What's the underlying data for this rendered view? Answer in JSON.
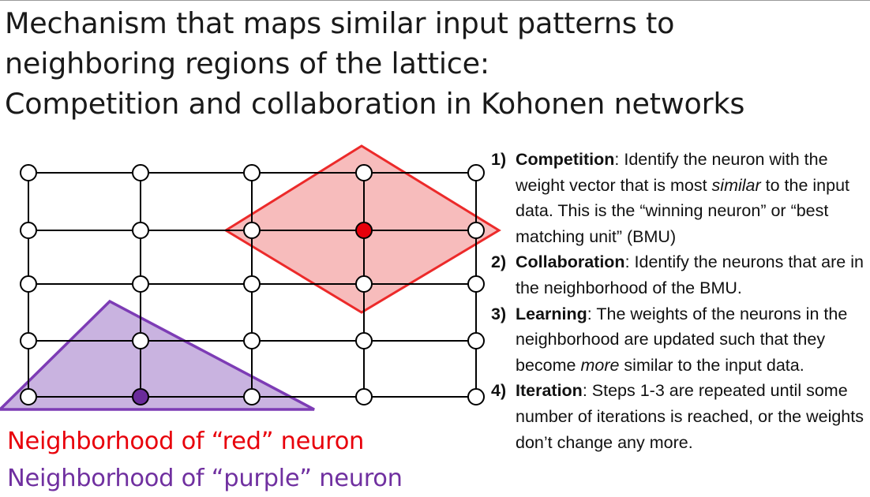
{
  "title": {
    "lines": [
      "Mechanism that maps similar input patterns to",
      "neighboring regions of the lattice:",
      "Competition and collaboration in Kohonen networks"
    ]
  },
  "diagram": {
    "grid": {
      "columns": 5,
      "rows": 5,
      "node_fill": "#ffffff",
      "line_color": "#000000"
    },
    "red_neuron": {
      "column": 4,
      "row": 2,
      "color": "#e8000b"
    },
    "purple_neuron": {
      "column": 2,
      "row": 5,
      "color": "#6a2b9b"
    },
    "red_region": {
      "fill": "#f4a6a6",
      "stroke": "#ec2a2a"
    },
    "purple_region": {
      "fill": "#c9b3e0",
      "stroke": "#7d3cb5"
    }
  },
  "legend": {
    "red": {
      "text": "Neighborhood of “red” neuron",
      "color": "#e8000b"
    },
    "purple": {
      "text": "Neighborhood of “purple” neuron",
      "color": "#7030a0"
    }
  },
  "steps": [
    {
      "num": "1)",
      "term": "Competition",
      "text_before": ": Identify the neuron with the weight vector that is most ",
      "emphasis": "similar",
      "text_after": " to the input data. This is the “winning neuron” or “best matching unit” (BMU)"
    },
    {
      "num": "2)",
      "term": "Collaboration",
      "text_before": ": Identify the neurons that are in the neighborhood of the BMU.",
      "emphasis": "",
      "text_after": ""
    },
    {
      "num": "3)",
      "term": "Learning",
      "text_before": ": The weights of the neurons in the neighborhood are updated such that they become ",
      "emphasis": "more",
      "text_after": " similar to the input data."
    },
    {
      "num": "4)",
      "term": "Iteration",
      "text_before": ": Steps 1-3 are repeated until some number of iterations is reached, or the weights don’t change any more.",
      "emphasis": "",
      "text_after": ""
    }
  ]
}
